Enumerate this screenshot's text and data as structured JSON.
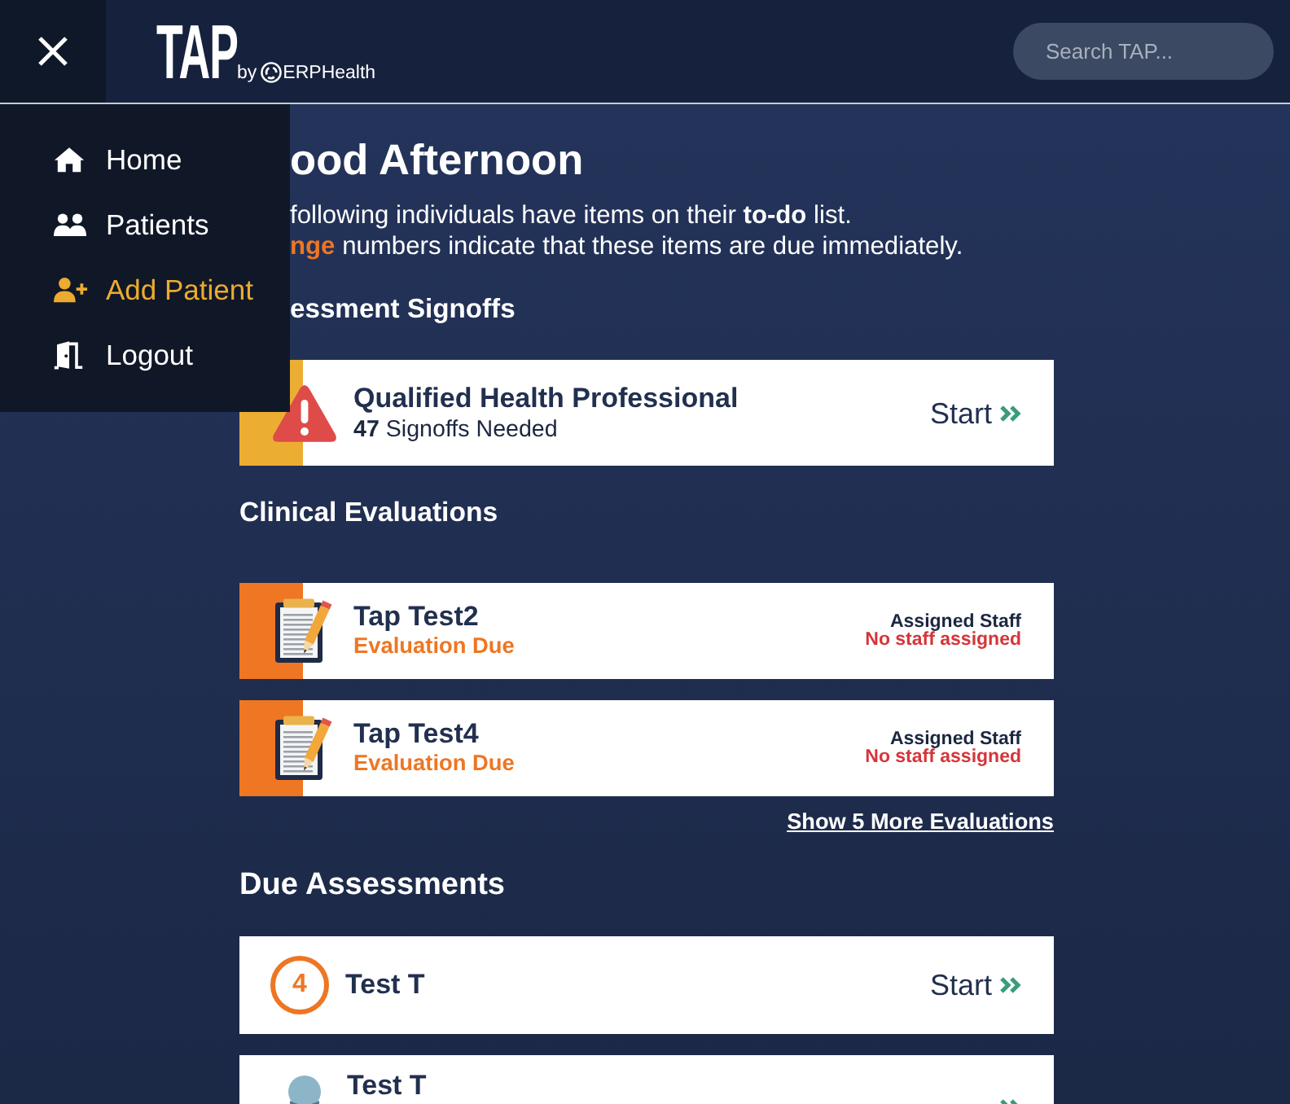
{
  "top_bar": {
    "logo": {
      "wordmark": "TAP",
      "byline": "by",
      "brand": "ERPHealth"
    },
    "search": {
      "placeholder": "Search TAP..."
    }
  },
  "menu": {
    "items": [
      {
        "kind": "home",
        "label": "Home",
        "selected": false
      },
      {
        "kind": "patients",
        "label": "Patients",
        "selected": false
      },
      {
        "kind": "add-patient",
        "label": "Add Patient",
        "selected": true
      },
      {
        "kind": "logout",
        "label": "Logout",
        "selected": false
      }
    ]
  },
  "greeting": {
    "title": "ood Afternoon",
    "lines": [
      {
        "text": "following individuals have items on their **to-do** list."
      },
      {
        "highlight": "nge",
        "text": " numbers indicate that these items are due immediately."
      }
    ]
  },
  "sections": [
    {
      "kind": "signoff",
      "title": "essment Signoffs",
      "cards": [
        {
          "title": "Qualified Health Professional",
          "detail": "**47** Signoffs Needed",
          "action": "Start"
        }
      ]
    },
    {
      "kind": "evaluation",
      "title": "Clinical Evaluations",
      "cards": [
        {
          "title": "Tap Test2",
          "status": "Evaluation Due",
          "staff_label": "Assigned Staff",
          "staff": "No staff assigned"
        },
        {
          "title": "Tap Test4",
          "status": "Evaluation Due",
          "staff_label": "Assigned Staff",
          "staff": "No staff assigned"
        }
      ],
      "more_link": "Show 5 More Evaluations"
    },
    {
      "kind": "assessment",
      "title": "Due Assessments",
      "cards": [
        {
          "marker": {
            "kind": "count",
            "text": "4"
          },
          "title": "Test T",
          "action": "Start"
        },
        {
          "marker": {
            "kind": "avatar"
          },
          "title": "Test T"
        }
      ]
    }
  ]
}
